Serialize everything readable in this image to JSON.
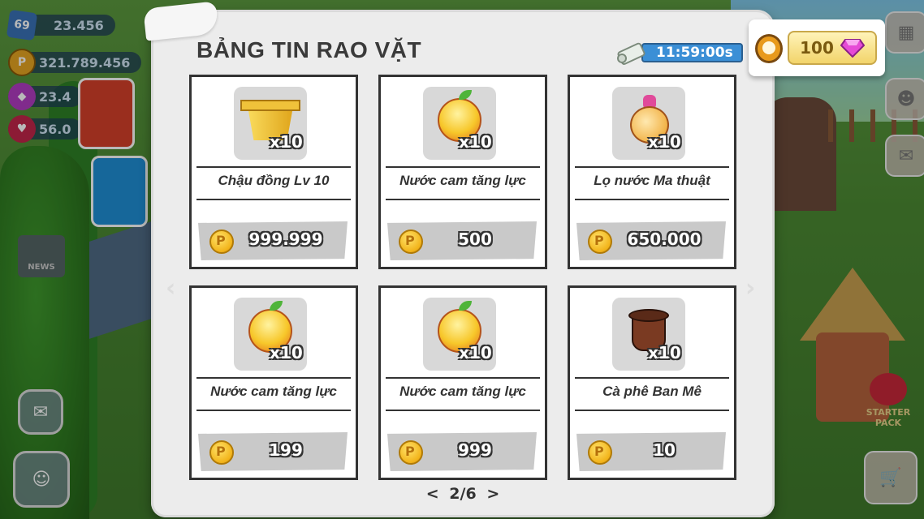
{
  "hud": {
    "level": "69",
    "xp": "23.456",
    "coins": "321.789.456",
    "gems": "23.4",
    "hearts": "56.0"
  },
  "side": {
    "news_label": "NEWS",
    "starter_pack_label": "STARTER PACK"
  },
  "panel": {
    "title": "BẢNG TIN RAO VẶT",
    "timer": "11:59:00s",
    "refresh_cost": "100",
    "page": "2/6",
    "prev_label": "<",
    "next_label": ">"
  },
  "items": [
    {
      "name": "Chậu đồng Lv 10",
      "qty": "x10",
      "price": "999.999",
      "icon": "golden-pot-icon"
    },
    {
      "name": "Nước cam tăng lực",
      "qty": "x10",
      "price": "500",
      "icon": "orange-juice-icon"
    },
    {
      "name": "Lọ nước Ma thuật",
      "qty": "x10",
      "price": "650.000",
      "icon": "magic-potion-icon"
    },
    {
      "name": "Nước cam tăng lực",
      "qty": "x10",
      "price": "199",
      "icon": "orange-juice-icon"
    },
    {
      "name": "Nước cam tăng lực",
      "qty": "x10",
      "price": "999",
      "icon": "orange-juice-icon"
    },
    {
      "name": "Cà phê Ban Mê",
      "qty": "x10",
      "price": "10",
      "icon": "coffee-drum-icon"
    }
  ],
  "colors": {
    "panel_bg": "#ececec",
    "timer_blue": "#3b8fd6",
    "gem_pink": "#e64bd6",
    "coin_gold": "#f2b31a"
  }
}
